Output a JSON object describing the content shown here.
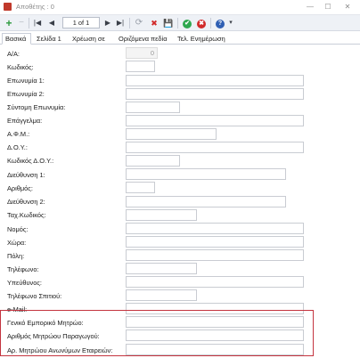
{
  "window": {
    "title": "Αποθέτης : 0",
    "minimize": "—",
    "maximize": "☐",
    "close": "✕"
  },
  "toolbar": {
    "add": "+",
    "delete": "−",
    "first": "|◀",
    "prev": "◀",
    "pager": "1 of 1",
    "next": "▶",
    "last": "▶|",
    "refresh": "⟳",
    "cancel": "✖",
    "save": "💾",
    "accept": "✔",
    "abort": "✖",
    "help": "?",
    "more": "▾",
    "colors": {
      "add": "#2e9b3f",
      "cancel": "#d12a2a",
      "accept": "#2fa84f",
      "abort": "#d12a2a",
      "help": "#2f5fb3"
    }
  },
  "tabs": [
    {
      "label": "Βασικά",
      "active": true
    },
    {
      "label": "Σελίδα 1",
      "active": false
    },
    {
      "label": "Χρέωση σε",
      "active": false
    },
    {
      "label": "Οριζόμενα πεδία",
      "active": false
    },
    {
      "label": "Τελ. Ενημέρωση",
      "active": false
    }
  ],
  "form": {
    "aa": {
      "label": "Α/Α:",
      "value": "0"
    },
    "code": {
      "label": "Κωδικός:"
    },
    "name1": {
      "label": "Επωνυμία 1:"
    },
    "name2": {
      "label": "Επωνυμία 2:"
    },
    "short_name": {
      "label": "Σύντομη Επωνυμία:"
    },
    "profession": {
      "label": "Επάγγελμα:"
    },
    "afm": {
      "label": "Α.Φ.Μ.:"
    },
    "doy": {
      "label": "Δ.Ο.Υ.:"
    },
    "doy_code": {
      "label": "Κωδικός Δ.Ο.Υ.:"
    },
    "address1": {
      "label": "Διεύθυνση 1:"
    },
    "number": {
      "label": "Αριθμός:"
    },
    "address2": {
      "label": "Διεύθυνση 2:"
    },
    "postal_code": {
      "label": "Ταχ.Κωδικός:"
    },
    "prefecture": {
      "label": "Νομός:"
    },
    "country": {
      "label": "Χώρα:"
    },
    "city": {
      "label": "Πόλη:"
    },
    "phone": {
      "label": "Τηλέφωνο:"
    },
    "responsible": {
      "label": "Υπεύθυνος:"
    },
    "home_phone": {
      "label": "Τηλέφωνο Σπιτιού:"
    },
    "email": {
      "label": "e-Mail:"
    },
    "gemi": {
      "label": "Γενικό Εμπορικό Μητρώο:"
    },
    "producers_registry": {
      "label": "Αριθμός Μητρώου Παραγωγού:"
    },
    "sa_registry": {
      "label": "Αρ. Μητρώου Ανωνύμων Εταιρειών:"
    }
  }
}
